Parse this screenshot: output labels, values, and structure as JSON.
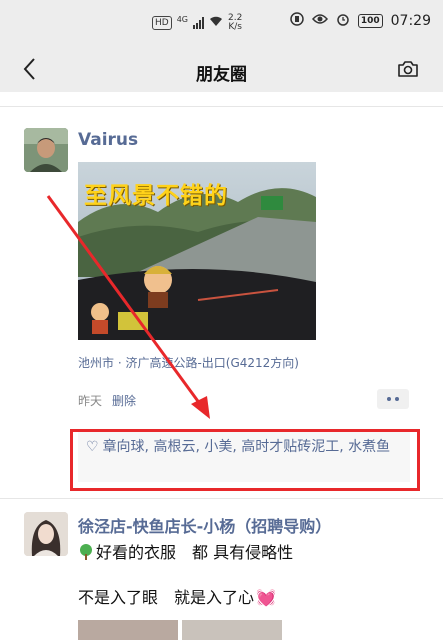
{
  "status_bar": {
    "hd": "HD",
    "network": "4G",
    "speed_value": "2.2",
    "speed_unit": "K/s",
    "battery": "100",
    "time": "07:29"
  },
  "nav": {
    "title": "朋友圈"
  },
  "post1": {
    "author": "Vairus",
    "image_caption": "至风景不错的",
    "location": "池州市 · 济广高速公路-出口(G4212方向)",
    "time": "昨天",
    "delete_label": "删除",
    "likes": "章向球, 高根云, 小美, 高时才贴砖泥工, 水煮鱼"
  },
  "post2": {
    "author": "徐泾店-快鱼店长-小杨（招聘导购）",
    "line1": "好看的衣服　都 具有侵略性",
    "line2": "不是入了眼　就是入了心"
  },
  "colors": {
    "link_blue": "#576b95",
    "highlight_red": "#e8282b",
    "caption_yellow": "#ffd21a"
  }
}
